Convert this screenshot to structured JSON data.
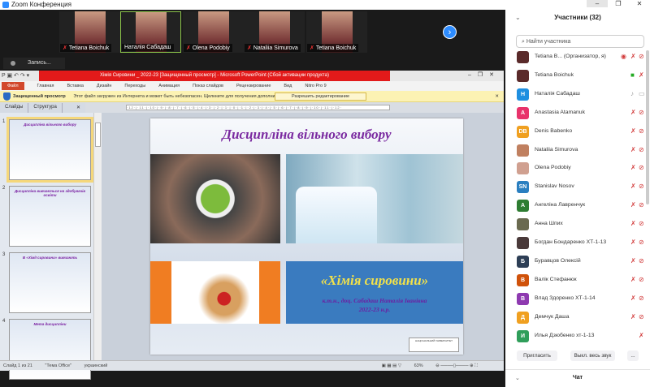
{
  "app_title": "Zoom Конференция",
  "video_strip": {
    "tiles": [
      {
        "name": "Tetiana Boichuk",
        "muted": true
      },
      {
        "name": "Наталія Сабадаш",
        "muted": false,
        "active": true
      },
      {
        "name": "Olena Podobiy",
        "muted": true
      },
      {
        "name": "Nataliia Simurova",
        "muted": true
      },
      {
        "name": "Tetiana Boichuk",
        "muted": true
      }
    ],
    "next_icon": "chevron-right-icon"
  },
  "recording": {
    "label": "Запись..."
  },
  "ppt": {
    "title": "Хімія Сировини _ 2022-23 [Защищенный просмотр] - Microsoft PowerPoint (Сбой активации продукта)",
    "tabs": [
      "Файл",
      "Главная",
      "Вставка",
      "Дизайн",
      "Переходы",
      "Анимация",
      "Показ слайдов",
      "Рецензирование",
      "Вид",
      "Nitro Pro 9"
    ],
    "protected": {
      "label": "Защищенный просмотр",
      "message": "Этот файл загружен из Интернета и может быть небезопасен. Щелкните для получения дополнительных сведений.",
      "button": "Разрешить редактирование"
    },
    "pane_tabs": [
      "Слайды",
      "Структура"
    ],
    "ruler": "·12·|·11·|·10·|·9·|·8·|·7·|·6·|·5·|·4·|·3·|·2·|·1·|·0·|·1·|·2·|·3·|·4·|·5·|·6·|·7·|·8·|·9·|·10·|·11·|·12·",
    "thumbnails": [
      {
        "num": "1",
        "title": "Дисципліна вільного вибору"
      },
      {
        "num": "2",
        "title": "Дисципліна вивчається на здобувачів освіти"
      },
      {
        "num": "3",
        "title": "В «Хімії сировини» вивчають"
      },
      {
        "num": "4",
        "title": "Мета дисципліни"
      }
    ],
    "slide": {
      "title": "Дисципліна вільного вибору",
      "subject": "«Хімія сировини»",
      "author": "к.т.н., доц. Сабадаш Наталія Іванівна",
      "year": "2022-23 н.р.",
      "logo_text": "НАЦІОНАЛЬНИЙ УНІВЕРСИТЕТ"
    },
    "status": {
      "slide": "Слайд 1 из 21",
      "theme": "\"Тема Office\"",
      "language": "украинский",
      "zoom": "63%"
    }
  },
  "participants": {
    "title": "Участники (32)",
    "search_placeholder": "Найти участника",
    "list": [
      {
        "name": "Tetiana B... (Организатор, я)",
        "initials": "",
        "color": "#5a2a2a"
      },
      {
        "name": "Tetiana Boichuk",
        "initials": "",
        "color": "#5a2a2a"
      },
      {
        "name": "Наталія Сабадаш",
        "initials": "H",
        "color": "#1f8fe0"
      },
      {
        "name": "Anastasia Atamanuk",
        "initials": "A",
        "color": "#e8336b"
      },
      {
        "name": "Denis Babenko",
        "initials": "DB",
        "color": "#f0a020"
      },
      {
        "name": "Nataliia Simurova",
        "initials": "",
        "color": "#c08060"
      },
      {
        "name": "Olena Podobiy",
        "initials": "",
        "color": "#d0a090"
      },
      {
        "name": "Stanislav Nosov",
        "initials": "SN",
        "color": "#2a7fc0"
      },
      {
        "name": "Ангеліна Лавренчук",
        "initials": "A",
        "color": "#2e7d32"
      },
      {
        "name": "Анна Шпих",
        "initials": "",
        "color": "#6a6a50"
      },
      {
        "name": "Богдан Бондаренко ХТ-1-13",
        "initials": "",
        "color": "#4a3a3a"
      },
      {
        "name": "Буравцов Олексій",
        "initials": "Б",
        "color": "#2d3e55"
      },
      {
        "name": "Валік Стефанюк",
        "initials": "В",
        "color": "#d0520a"
      },
      {
        "name": "Влад Здоренко ХТ-1-14",
        "initials": "В",
        "color": "#8e3ab0"
      },
      {
        "name": "Демчук Даша",
        "initials": "Д",
        "color": "#f0a020"
      },
      {
        "name": "Илья Дзюбенко хт-1-13",
        "initials": "И",
        "color": "#2f9e5a"
      }
    ],
    "buttons": {
      "invite": "Пригласить",
      "mute_all": "Выкл. весь звук",
      "more": "..."
    },
    "chat": "Чат"
  }
}
